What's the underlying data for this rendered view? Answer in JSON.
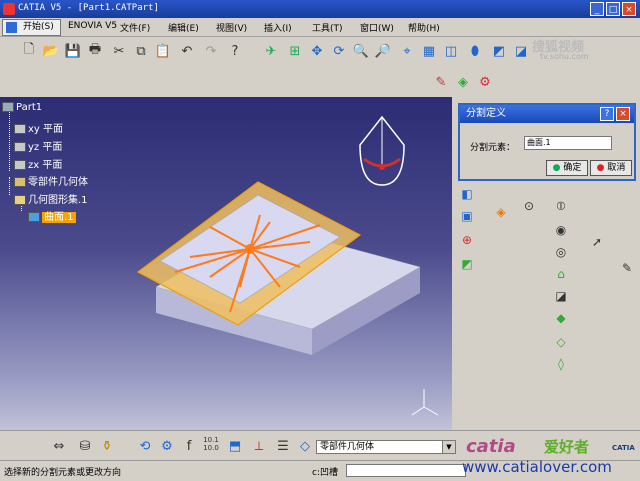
{
  "window": {
    "title": "CATIA V5 - [Part1.CATPart]",
    "min": "_",
    "max": "□",
    "close": "×"
  },
  "menubar": {
    "start": "开始(S)",
    "items": [
      "ENOVIA V5",
      "文件(F)",
      "编辑(E)",
      "视图(V)",
      "插入(I)",
      "工具(T)",
      "窗口(W)",
      "帮助(H)"
    ]
  },
  "tree": {
    "root": "Part1",
    "items": [
      "xy 平面",
      "yz 平面",
      "zx 平面",
      "零部件几何体",
      "几何图形集.1",
      "曲面.1"
    ]
  },
  "dialog": {
    "title": "分割定义",
    "help": "?",
    "close": "×",
    "field_label": "分割元素：",
    "field_value": "曲面.1",
    "ok": "确定",
    "cancel": "取消"
  },
  "bottom": {
    "body_combo": "零部件几何体",
    "scale_text": "10.1\n10.0"
  },
  "status": {
    "message": "选择新的分割元素或更改方向",
    "cmd_label": "c:凹槽"
  },
  "watermarks": {
    "sohu": "搜狐视频",
    "sohu_url": "tv.sohu.com",
    "catia": "catia",
    "aihaozhe": "爱好者",
    "url": "www.catialover.com",
    "logo": "CATIA"
  },
  "colors": {
    "accent": "#3065c8",
    "selection": "#f4a300",
    "split": "#ff7a1a",
    "plane": "#f0c060"
  }
}
